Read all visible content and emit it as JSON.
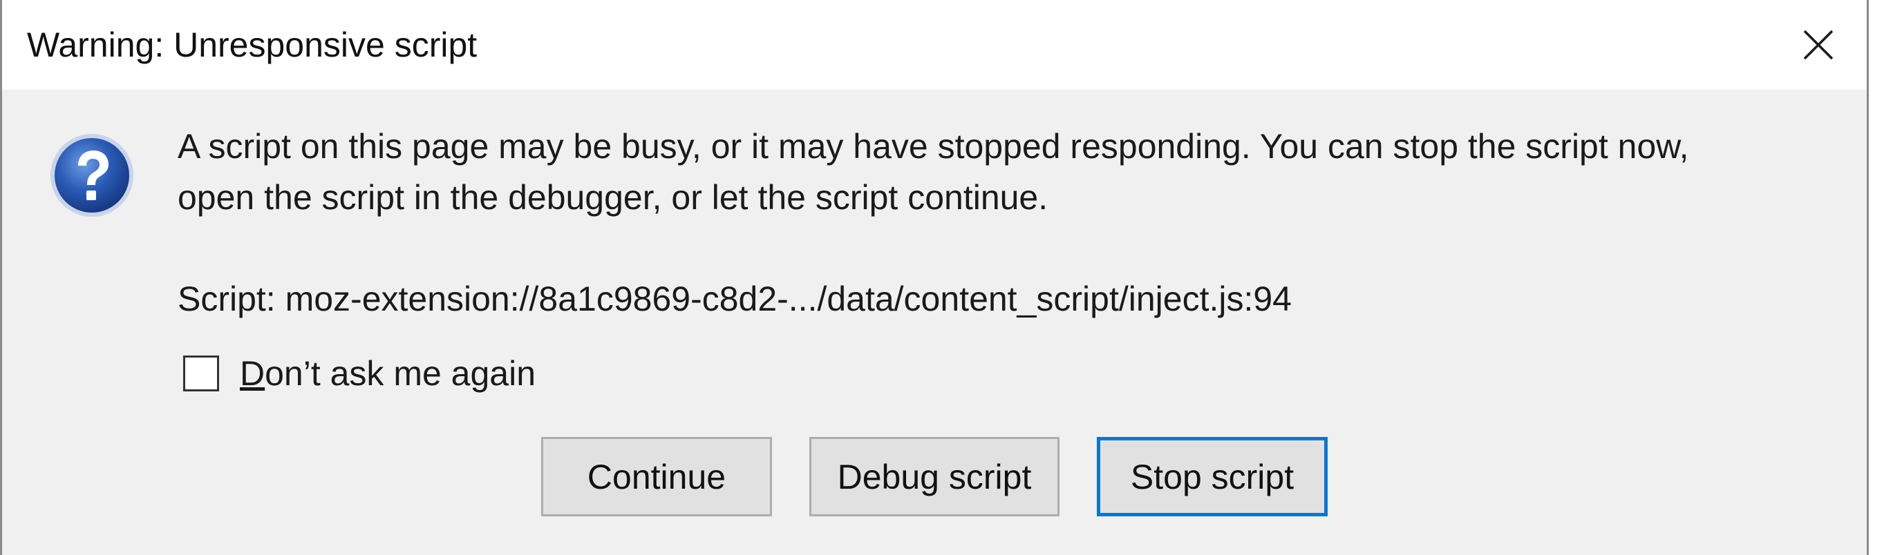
{
  "dialog": {
    "title": "Warning: Unresponsive script",
    "close_icon": "close-icon",
    "message_icon": "question-icon",
    "message_line1": "A script on this page may be busy, or it may have stopped responding. You can stop the script now,",
    "message_line2": "open the script in the debugger, or let the script continue.",
    "script_info": "Script: moz-extension://8a1c9869-c8d2-.../data/content_script/inject.js:94",
    "checkbox": {
      "label_accel": "D",
      "label_rest": "on’t ask me again",
      "checked": false
    },
    "buttons": {
      "continue": "Continue",
      "debug": "Debug script",
      "stop": "Stop script"
    },
    "colors": {
      "focus_border": "#0078d7",
      "icon_blue": "#2a5bb5",
      "dialog_bg": "#f0f0f0"
    }
  }
}
